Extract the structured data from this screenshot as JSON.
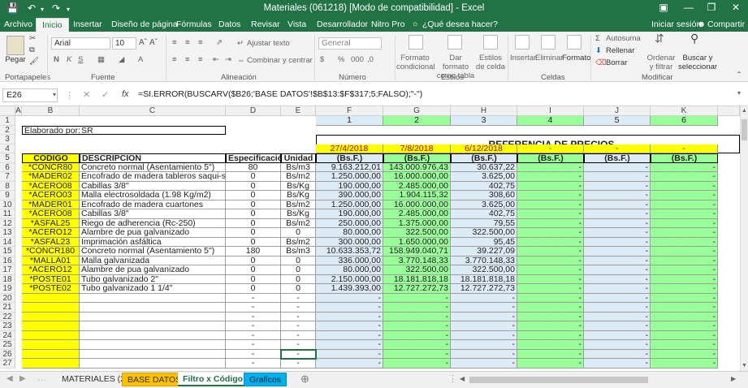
{
  "window": {
    "title": "Materiales (061218)  [Modo de compatibilidad] - Excel"
  },
  "ribbon_tabs": [
    "Archivo",
    "Inicio",
    "Insertar",
    "Diseño de página",
    "Fórmulas",
    "Datos",
    "Revisar",
    "Vista",
    "Desarrollador",
    "Nitro Pro"
  ],
  "tell_me": "¿Qué desea hacer?",
  "signin": "Iniciar sesión",
  "share": "Compartir",
  "ribbon": {
    "paste": "Pegar",
    "font_name": "Arial",
    "font_size": "10",
    "wrap": "Ajustar texto",
    "merge": "Combinar y centrar",
    "number_format": "General",
    "cond_format": "Formato condicional",
    "format_table": "Dar formato como tabla",
    "cell_styles": "Estilos de celda",
    "insert": "Insertar",
    "delete": "Eliminar",
    "format": "Formato",
    "autosum": "Autosuma",
    "fill": "Rellenar",
    "clear": "Borrar",
    "sort": "Ordenar y filtrar",
    "find": "Buscar y seleccionar",
    "groups": [
      "Portapapeles",
      "Fuente",
      "Alineación",
      "Número",
      "Estilos",
      "Celdas",
      "Modificar"
    ]
  },
  "namebox": "E26",
  "formula": "=SI.ERROR(BUSCARV($B26;'BASE DATOS'!$B$13:$F$317;5;FALSO);\"-\")",
  "columns": [
    "A",
    "B",
    "C",
    "D",
    "E",
    "F",
    "G",
    "H",
    "I",
    "J",
    "K"
  ],
  "header": {
    "ref_numbers": [
      "1",
      "2",
      "3",
      "4",
      "5",
      "6"
    ],
    "elaborado_label": "Elaborado por:",
    "elaborado_value": "SR",
    "ref_title": "REFERENCIA DE PRECIOS",
    "dates": [
      "27/4/2018",
      "7/8/2018",
      "6/12/2018",
      "-",
      "-",
      "-"
    ],
    "col_codigo": "CODIGO",
    "col_desc": "DESCRIPCION",
    "col_spec": "Especificación",
    "col_unit": "Unidad",
    "currency": "(Bs.F.)"
  },
  "rows": [
    {
      "code": "*CONCR80",
      "desc": "Concreto normal (Asentamiento 5\")",
      "spec": "80",
      "unit": "Bs/m3",
      "p1": "9.163.212,01",
      "p2": "143.000.976,43",
      "p3": "30.637,22"
    },
    {
      "code": "*MADER02",
      "desc": "Encofrado de madera tableros saqui-saqui",
      "spec": "0",
      "unit": "Bs/m2",
      "p1": "1.250.000,00",
      "p2": "16.000.000,00",
      "p3": "3.625,00"
    },
    {
      "code": "*ACERO08",
      "desc": "Cabillas 3/8\"",
      "spec": "0",
      "unit": "Bs/Kg",
      "p1": "190.000,00",
      "p2": "2.485.000,00",
      "p3": "402,75"
    },
    {
      "code": "*ACERO03",
      "desc": "Malla electrosoldada (1.98 Kg/m2)",
      "spec": "0",
      "unit": "Bs/Kg",
      "p1": "390.000,00",
      "p2": "1.904.115,32",
      "p3": "308,60"
    },
    {
      "code": "*MADER01",
      "desc": "Encofrado de madera cuartones",
      "spec": "0",
      "unit": "Bs/m2",
      "p1": "1.250.000,00",
      "p2": "16.000.000,00",
      "p3": "3.625,00"
    },
    {
      "code": "*ACERO08",
      "desc": "Cabillas 3/8\"",
      "spec": "0",
      "unit": "Bs/Kg",
      "p1": "190.000,00",
      "p2": "2.485.000,00",
      "p3": "402,75"
    },
    {
      "code": "*ASFAL25",
      "desc": "Riego de adherencia (Rc-250)",
      "spec": "0",
      "unit": "Bs/m2",
      "p1": "250.000,00",
      "p2": "1.375.000,00",
      "p3": "79,55"
    },
    {
      "code": "*ACERO12",
      "desc": "Alambre de pua galvanizado",
      "spec": "0",
      "unit": "0",
      "p1": "80.000,00",
      "p2": "322.500,00",
      "p3": "322.500,00"
    },
    {
      "code": "*ASFAL23",
      "desc": "Imprimación asfáltica",
      "spec": "0",
      "unit": "Bs/m2",
      "p1": "300.000,00",
      "p2": "1.650.000,00",
      "p3": "95,45"
    },
    {
      "code": "*CONCR180",
      "desc": "Concreto normal (Asentamiento 5\")",
      "spec": "180",
      "unit": "Bs/m3",
      "p1": "10.633.353,72",
      "p2": "158.949.040,71",
      "p3": "39.227,09"
    },
    {
      "code": "*MALLA01",
      "desc": "Malla galvanizada",
      "spec": "0",
      "unit": "0",
      "p1": "336.000,00",
      "p2": "3.770.148,33",
      "p3": "3.770.148,33"
    },
    {
      "code": "*ACERO12",
      "desc": "Alambre de pua galvanizado",
      "spec": "0",
      "unit": "0",
      "p1": "80.000,00",
      "p2": "322.500,00",
      "p3": "322.500,00"
    },
    {
      "code": "*POSTE01",
      "desc": "Tubo galvanizado 2\"",
      "spec": "0",
      "unit": "0",
      "p1": "2.150.000,00",
      "p2": "18.181.818,18",
      "p3": "18.181.818,18"
    },
    {
      "code": "*POSTE02",
      "desc": "Tubo galvanizado 1 1/4\"",
      "spec": "0",
      "unit": "0",
      "p1": "1.439.393,00",
      "p2": "12.727.272,73",
      "p3": "12.727.272,73"
    }
  ],
  "dash": "-",
  "sheets": [
    "MATERIALES (2)",
    "BASE DATOS",
    "Filtro x Código",
    "Graficos"
  ],
  "colors": {
    "excel_green": "#217346",
    "green_fill": "#99ff99",
    "blue_fill": "#ddebf7",
    "yellow_fill": "#ffff00",
    "orange_text": "#c00000"
  }
}
